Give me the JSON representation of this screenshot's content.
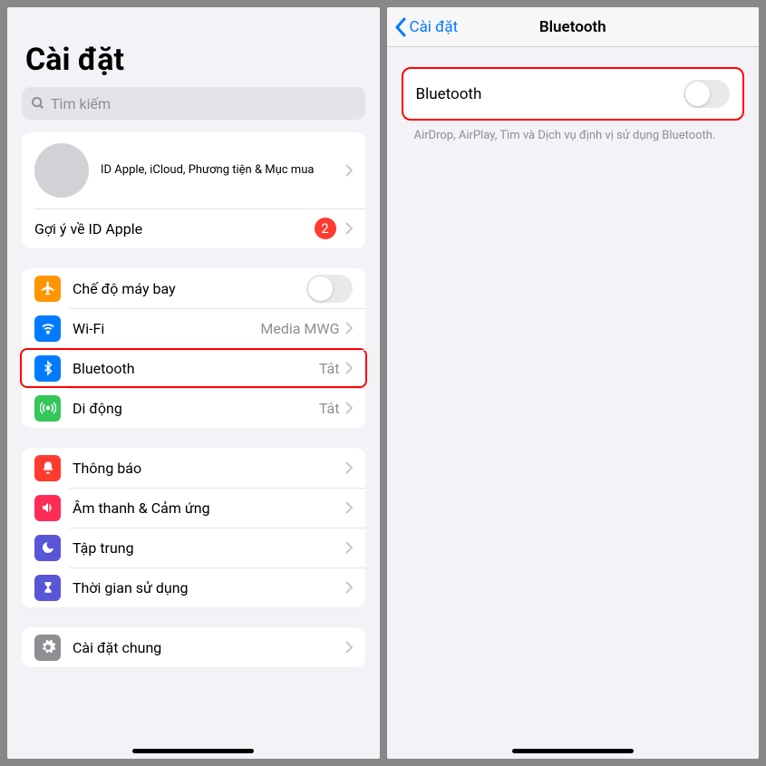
{
  "left": {
    "title": "Cài đặt",
    "search_placeholder": "Tìm kiếm",
    "profile": {
      "subtitle": "ID Apple, iCloud, Phương tiện & Mục mua",
      "suggestion_label": "Gợi ý về ID Apple",
      "badge_count": "2"
    },
    "connectivity": {
      "airplane": "Chế độ máy bay",
      "wifi": "Wi-Fi",
      "wifi_value": "Media MWG",
      "bluetooth": "Bluetooth",
      "bluetooth_value": "Tắt",
      "cellular": "Di động",
      "cellular_value": "Tắt"
    },
    "general1": {
      "notifications": "Thông báo",
      "sounds": "Âm thanh & Cảm ứng",
      "focus": "Tập trung",
      "screentime": "Thời gian sử dụng"
    },
    "general2": {
      "general": "Cài đặt chung"
    }
  },
  "right": {
    "back_label": "Cài đặt",
    "title": "Bluetooth",
    "toggle_label": "Bluetooth",
    "footer": "AirDrop, AirPlay, Tìm và Dịch vụ định vị sử dụng Bluetooth."
  }
}
